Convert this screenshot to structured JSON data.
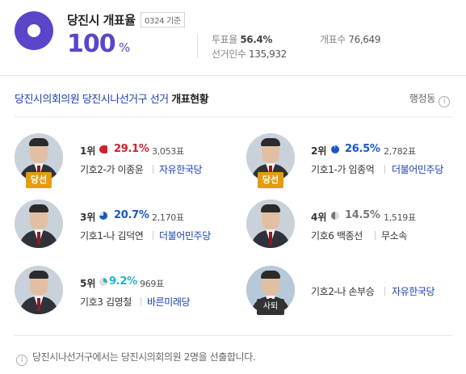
{
  "header": {
    "title": "당진시 개표율",
    "base_time": "0324 기준",
    "count_rate": "100",
    "count_rate_unit": "%",
    "turnout_label": "투표율",
    "turnout_value": "56.4%",
    "counted_label": "개표수",
    "counted_value": "76,649",
    "electorate_label": "선거인수",
    "electorate_value": "135,932",
    "accent_color": "#5b45c8"
  },
  "section": {
    "title_blue": "당진시의회의원 당진시나선거구 선거",
    "title_black": "개표현황",
    "admin_label": "행정동",
    "info_icon": "info-icon"
  },
  "candidates": [
    {
      "rank": "1위",
      "pct": "29.1%",
      "pct_value": 29.1,
      "votes": "3,053표",
      "number": "기호2-가",
      "name": "이종윤",
      "party": "자유한국당",
      "badge": "당선",
      "color": "#d0202e"
    },
    {
      "rank": "2위",
      "pct": "26.5%",
      "pct_value": 26.5,
      "votes": "2,782표",
      "number": "기호1-가",
      "name": "임종억",
      "party": "더불어민주당",
      "badge": "당선",
      "color": "#1b57c7"
    },
    {
      "rank": "3위",
      "pct": "20.7%",
      "pct_value": 20.7,
      "votes": "2,170표",
      "number": "기호1-나",
      "name": "김덕연",
      "party": "더불어민주당",
      "badge": "",
      "color": "#1b57c7"
    },
    {
      "rank": "4위",
      "pct": "14.5%",
      "pct_value": 14.5,
      "votes": "1,519표",
      "number": "기호6",
      "name": "백종선",
      "party": "무소속",
      "badge": "",
      "color": "#777777"
    },
    {
      "rank": "5위",
      "pct": "9.2%",
      "pct_value": 9.2,
      "votes": "969표",
      "number": "기호3",
      "name": "김영철",
      "party": "바른미래당",
      "badge": "",
      "color": "#20b2c5"
    },
    {
      "rank": "",
      "pct": "",
      "votes": "",
      "number": "기호2-나",
      "name": "손부승",
      "party": "자유한국당",
      "badge": "사퇴",
      "color": ""
    }
  ],
  "footer": {
    "text": "당진시나선거구에서는 당진시의회의원 2명을 선출합니다."
  }
}
